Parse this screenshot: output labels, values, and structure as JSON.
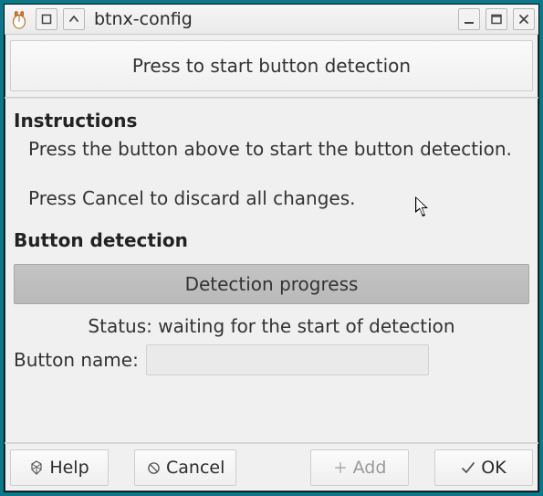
{
  "window": {
    "title": "btnx-config"
  },
  "detect_button": {
    "label": "Press to start button detection"
  },
  "instructions": {
    "heading": "Instructions",
    "text": "Press the button above to start the button detection.\n\nPress Cancel to discard all changes."
  },
  "detection": {
    "heading": "Button detection",
    "progress_label": "Detection progress",
    "status_text": "Status: waiting for the start of detection",
    "name_label": "Button name:",
    "name_value": ""
  },
  "actions": {
    "help": "Help",
    "cancel": "Cancel",
    "add": "Add",
    "ok": "OK"
  }
}
